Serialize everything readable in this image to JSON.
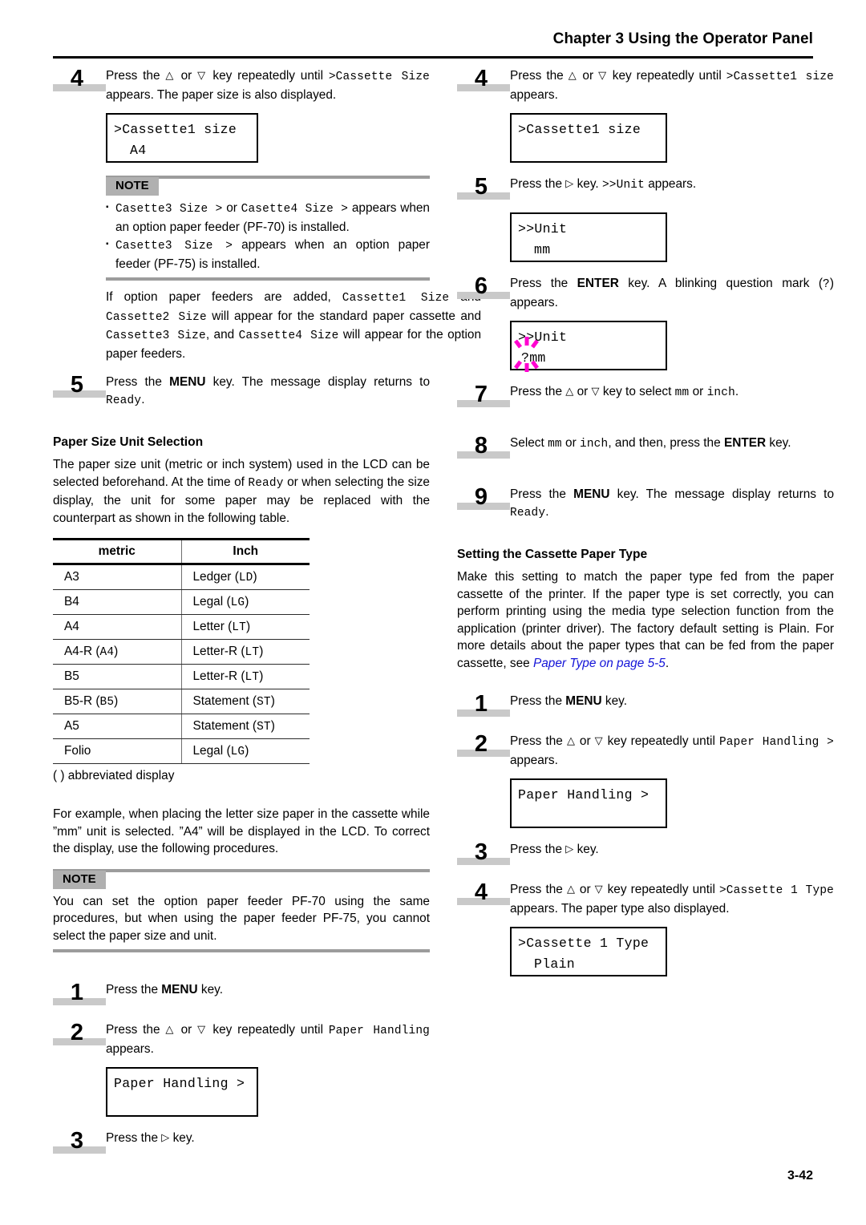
{
  "header": {
    "chapter_title": "Chapter 3  Using the Operator Panel"
  },
  "page_number": "3-42",
  "left_column": {
    "step4": {
      "number": "4",
      "text_parts": {
        "p1": "Press the ",
        "key_up": "△",
        "p2": " or ",
        "key_down": "▽",
        "p3": " key repeatedly until ",
        "mono1": ">Cassette Size",
        "p4": " appears. The paper size is also displayed."
      }
    },
    "lcd1": {
      "line1": ">Cassette1 size",
      "line2": "A4"
    },
    "note1": {
      "tag": "NOTE",
      "bullets": [
        {
          "mono1": "Casette3 Size >",
          "mid": " or ",
          "mono2": "Casette4 Size >",
          "tail": " appears when an option paper feeder (PF-70) is installed."
        },
        {
          "mono1": "Casette3  Size  >",
          "mid": "",
          "mono2": "",
          "tail": " appears when an option paper feeder (PF-75) is installed."
        }
      ]
    },
    "para_feeders": {
      "a": "If option paper feeders are added, ",
      "m1": "Cassette1  Size",
      "b": " and ",
      "m2": "Cassette2  Size",
      "c": " will appear for the standard paper cassette and ",
      "m3": "Cassette3  Size",
      "d": ", and ",
      "m4": "Cassette4  Size",
      "e": " will appear for the option paper feeders."
    },
    "step5": {
      "number": "5",
      "a": "Press the ",
      "menu": "MENU",
      "b": " key. The message display returns to ",
      "m": "Ready",
      "c": "."
    },
    "unit_section": {
      "heading": "Paper Size Unit Selection",
      "para_a": "The paper size unit (metric or inch system) used in the LCD can be selected beforehand. At the time of ",
      "para_mono": "Ready",
      "para_b": " or when selecting the size display, the unit for some paper may be replaced with the counterpart as shown in the following table."
    },
    "table": {
      "headers": [
        "metric",
        "Inch"
      ],
      "rows": [
        {
          "metric": "A3",
          "metric_abbr": "",
          "inch": "Ledger",
          "inch_abbr": "LD"
        },
        {
          "metric": "B4",
          "metric_abbr": "",
          "inch": "Legal",
          "inch_abbr": "LG"
        },
        {
          "metric": "A4",
          "metric_abbr": "",
          "inch": "Letter",
          "inch_abbr": "LT"
        },
        {
          "metric": "A4-R",
          "metric_abbr": "A4",
          "inch": "Letter-R",
          "inch_abbr": "LT"
        },
        {
          "metric": "B5",
          "metric_abbr": "",
          "inch": "Letter-R",
          "inch_abbr": "LT"
        },
        {
          "metric": "B5-R",
          "metric_abbr": "B5",
          "inch": "Statement",
          "inch_abbr": "ST"
        },
        {
          "metric": "A5",
          "metric_abbr": "",
          "inch": "Statement",
          "inch_abbr": "ST"
        },
        {
          "metric": "Folio",
          "metric_abbr": "",
          "inch": "Legal",
          "inch_abbr": "LG"
        }
      ],
      "caption": "(  ) abbreviated display"
    },
    "para_example": "For example, when placing the letter size paper in the cassette while ”mm” unit is selected. ”A4” will be displayed in the LCD. To correct the display, use the following procedures.",
    "note2": {
      "tag": "NOTE",
      "body": "You can set the option paper feeder PF-70 using the same procedures, but when using the paper feeder PF-75, you cannot select the paper size and unit."
    },
    "step1": {
      "number": "1",
      "a": "Press the ",
      "menu": "MENU",
      "b": " key."
    },
    "step2": {
      "number": "2",
      "a": "Press the ",
      "key_up": "△",
      "b": " or ",
      "key_down": "▽",
      "c": " key repeatedly until ",
      "m1": "Paper Handling",
      "d": " appears."
    },
    "lcd2": {
      "line1": "Paper Handling >",
      "line2": ""
    },
    "step3": {
      "number": "3",
      "a": "Press the ",
      "key_right": "▷",
      "b": " key."
    }
  },
  "right_column": {
    "step4": {
      "number": "4",
      "a": "Press the ",
      "key_up": "△",
      "b": " or ",
      "key_down": "▽",
      "c": " key repeatedly until ",
      "m1": ">Cassette1 size",
      "d": " appears."
    },
    "lcd1": {
      "line1": ">Cassette1 size",
      "line2": ""
    },
    "step5": {
      "number": "5",
      "a": "Press the ",
      "key_right": "▷",
      "b": " key. ",
      "m1": ">>Unit",
      "c": " appears."
    },
    "lcd2": {
      "line1": ">>Unit",
      "line2": "mm"
    },
    "step6": {
      "number": "6",
      "a": "Press the ",
      "enter": "ENTER",
      "b": " key. A blinking question mark (",
      "m1": "?",
      "c": ") appears."
    },
    "lcd3": {
      "line1": ">>Unit",
      "blink": "?",
      "line2": "mm"
    },
    "step7": {
      "number": "7",
      "a": "Press the ",
      "key_up": "△",
      "b": " or ",
      "key_down": "▽",
      "c": " key to select ",
      "m1": "mm",
      "d": " or ",
      "m2": "inch",
      "e": "."
    },
    "step8": {
      "number": "8",
      "a": "Select ",
      "m1": "mm",
      "b": " or ",
      "m2": "inch",
      "c": ", and then, press the ",
      "enter": "ENTER",
      "d": " key."
    },
    "step9": {
      "number": "9",
      "a": "Press the ",
      "menu": "MENU",
      "b": " key. The message display returns to ",
      "m1": "Ready",
      "c": "."
    },
    "type_section": {
      "heading": "Setting the Cassette Paper Type",
      "para_a": "Make this setting to match the paper type fed from the paper cassette of the printer. If the paper type is set correctly, you can perform printing using the media type selection function from the application (printer driver). The factory default setting is Plain. For more details about the paper types that can be fed from the paper cassette, see ",
      "link": "Paper Type on page 5-5",
      "para_b": "."
    },
    "step1": {
      "number": "1",
      "a": "Press the ",
      "menu": "MENU",
      "b": " key."
    },
    "step2": {
      "number": "2",
      "a": "Press the ",
      "key_up": "△",
      "b": " or ",
      "key_down": "▽",
      "c": " key repeatedly until ",
      "m1": "Paper Handling >",
      "d": " appears."
    },
    "lcd4": {
      "line1": "Paper Handling >",
      "line2": ""
    },
    "step3": {
      "number": "3",
      "a": "Press the ",
      "key_right": "▷",
      "b": " key."
    },
    "step4b": {
      "number": "4",
      "a": "Press the ",
      "key_up": "△",
      "b": " or ",
      "key_down": "▽",
      "c": " key repeatedly until ",
      "m1": ">Cassette 1 Type",
      "d": " appears. The paper type also displayed."
    },
    "lcd5": {
      "line1": ">Cassette 1 Type",
      "line2": "Plain"
    }
  },
  "colors": {
    "blink_magenta": "#ff00d0",
    "link_blue": "#1414d8",
    "note_gray": "#9c9c9c",
    "tag_gray": "#b0b0b0",
    "step_bar_gray": "#c9c9c9"
  }
}
